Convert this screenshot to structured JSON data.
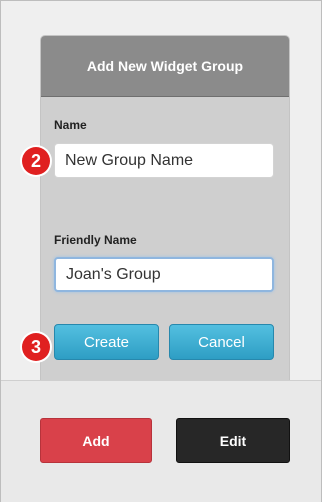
{
  "dialog": {
    "title": "Add New Widget Group",
    "name_label": "Name",
    "name_value": "New Group Name",
    "friendly_label": "Friendly Name",
    "friendly_value": "Joan's Group",
    "create_label": "Create",
    "cancel_label": "Cancel"
  },
  "annotations": {
    "step_name": "2",
    "step_create": "3"
  },
  "actions": {
    "add_label": "Add",
    "edit_label": "Edit"
  },
  "colors": {
    "badge": "#e02020",
    "add_button": "#d9414a",
    "edit_button": "#272727",
    "primary_button": "#2e9ec4"
  }
}
